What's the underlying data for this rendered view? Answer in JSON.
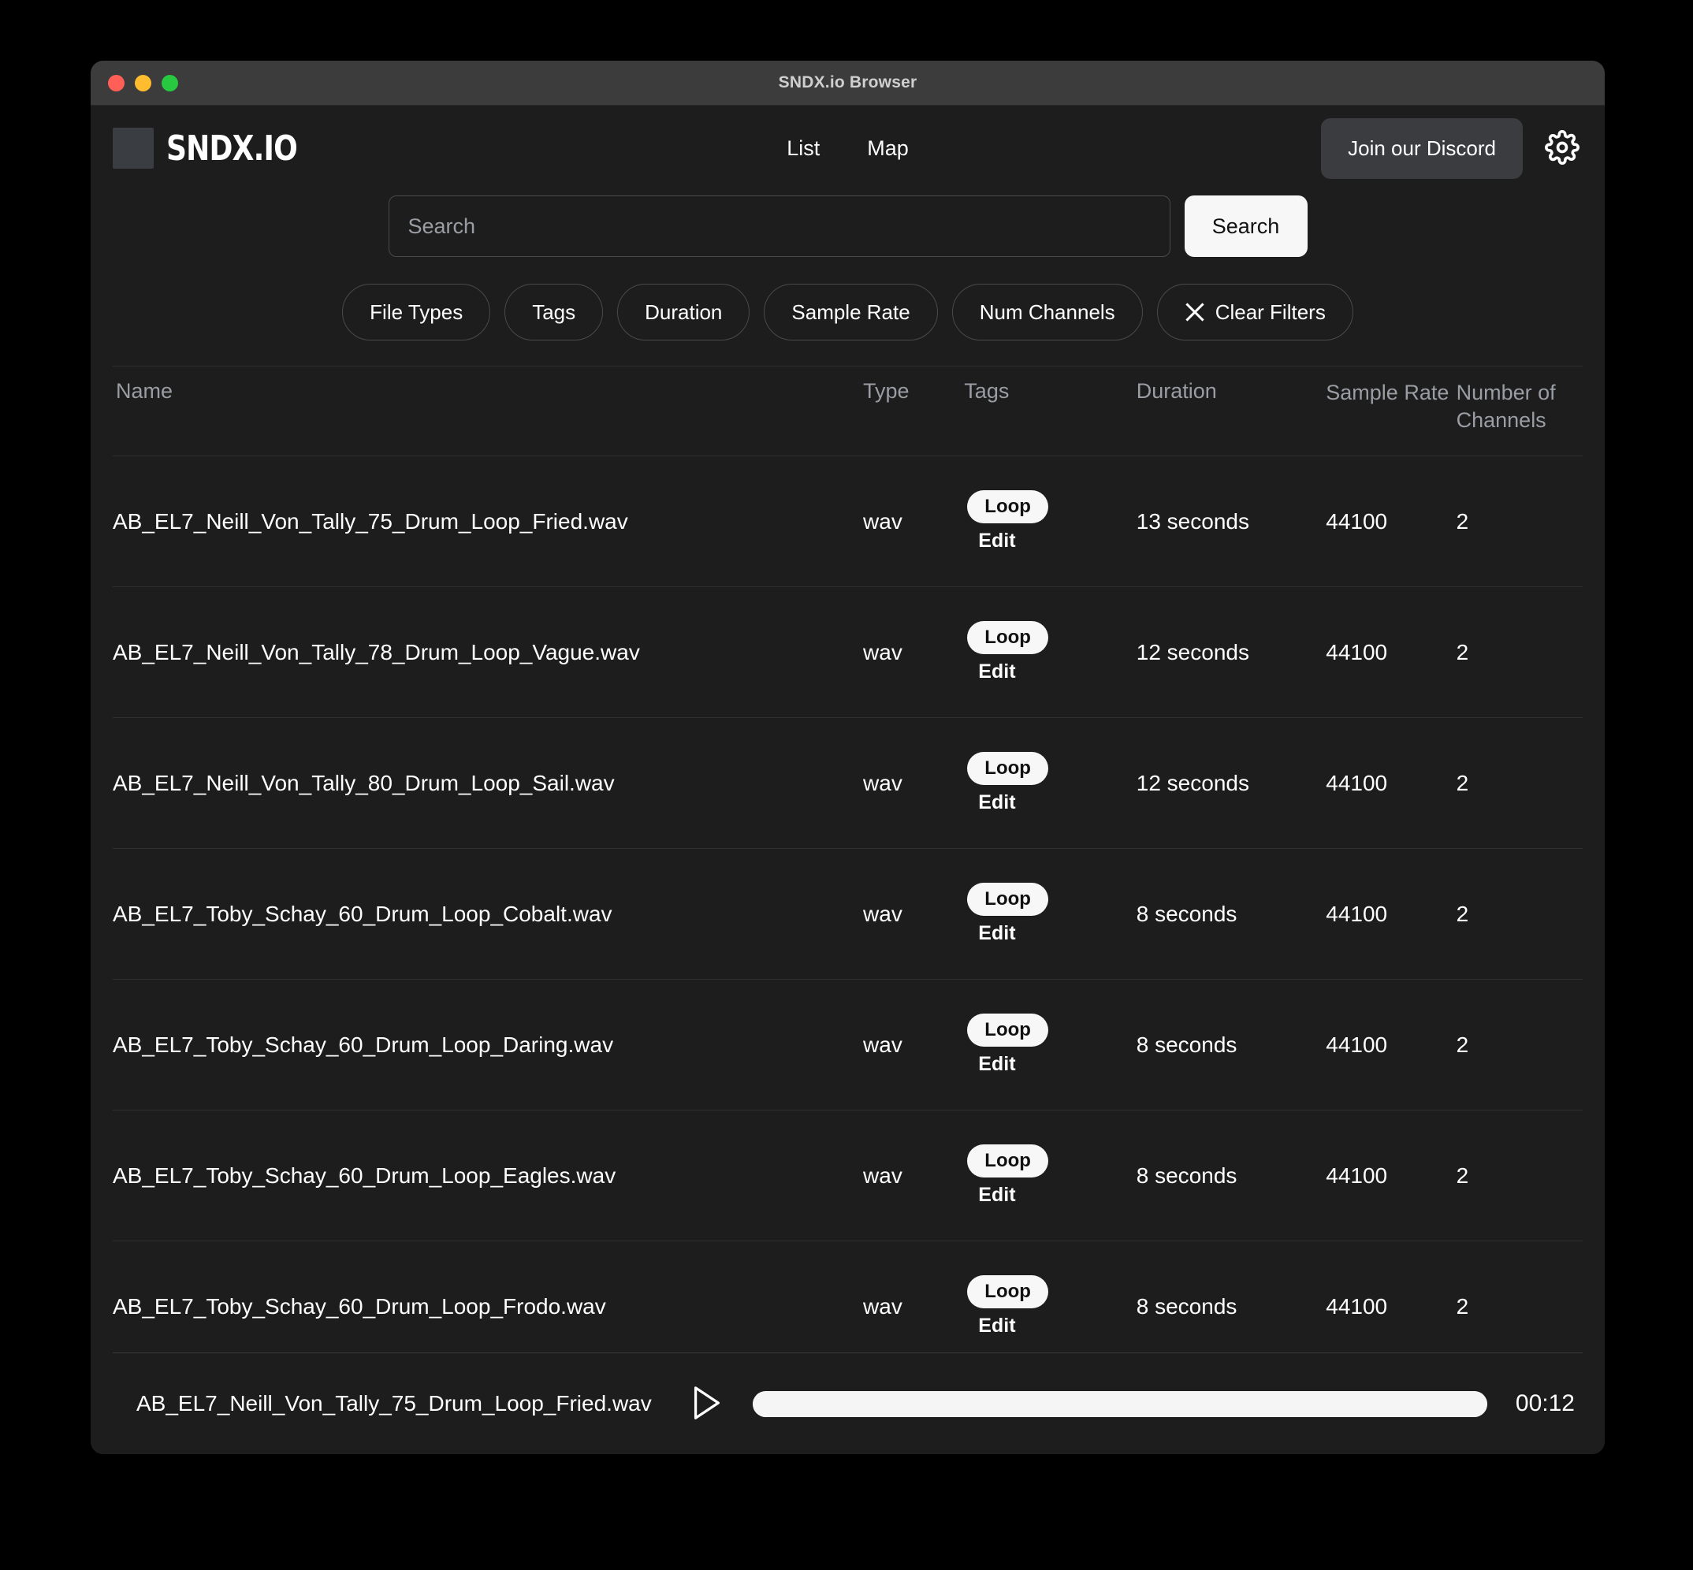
{
  "window": {
    "title": "SNDX.io Browser",
    "controls": [
      "close",
      "minimize",
      "maximize"
    ]
  },
  "header": {
    "brand_name": "SNDX.IO",
    "nav": [
      {
        "label": "List"
      },
      {
        "label": "Map"
      }
    ],
    "discord_label": "Join our Discord",
    "settings_icon": "gear-icon"
  },
  "search": {
    "value": "",
    "placeholder": "Search",
    "button_label": "Search"
  },
  "filters": [
    {
      "label": "File Types",
      "icon": null
    },
    {
      "label": "Tags",
      "icon": null
    },
    {
      "label": "Duration",
      "icon": null
    },
    {
      "label": "Sample Rate",
      "icon": null
    },
    {
      "label": "Num Channels",
      "icon": null
    },
    {
      "label": "Clear Filters",
      "icon": "x-icon"
    }
  ],
  "table": {
    "columns": [
      {
        "key": "name",
        "label": "Name"
      },
      {
        "key": "type",
        "label": "Type"
      },
      {
        "key": "tags",
        "label": "Tags"
      },
      {
        "key": "duration",
        "label": "Duration"
      },
      {
        "key": "sample_rate",
        "label": "Sample Rate"
      },
      {
        "key": "channels",
        "label": "Number of Channels"
      }
    ],
    "edit_label": "Edit",
    "rows": [
      {
        "name": "AB_EL7_Neill_Von_Tally_75_Drum_Loop_Fried.wav",
        "type": "wav",
        "tag": "Loop",
        "duration": "13 seconds",
        "sample_rate": "44100",
        "channels": "2"
      },
      {
        "name": "AB_EL7_Neill_Von_Tally_78_Drum_Loop_Vague.wav",
        "type": "wav",
        "tag": "Loop",
        "duration": "12 seconds",
        "sample_rate": "44100",
        "channels": "2"
      },
      {
        "name": "AB_EL7_Neill_Von_Tally_80_Drum_Loop_Sail.wav",
        "type": "wav",
        "tag": "Loop",
        "duration": "12 seconds",
        "sample_rate": "44100",
        "channels": "2"
      },
      {
        "name": "AB_EL7_Toby_Schay_60_Drum_Loop_Cobalt.wav",
        "type": "wav",
        "tag": "Loop",
        "duration": "8 seconds",
        "sample_rate": "44100",
        "channels": "2"
      },
      {
        "name": "AB_EL7_Toby_Schay_60_Drum_Loop_Daring.wav",
        "type": "wav",
        "tag": "Loop",
        "duration": "8 seconds",
        "sample_rate": "44100",
        "channels": "2"
      },
      {
        "name": "AB_EL7_Toby_Schay_60_Drum_Loop_Eagles.wav",
        "type": "wav",
        "tag": "Loop",
        "duration": "8 seconds",
        "sample_rate": "44100",
        "channels": "2"
      },
      {
        "name": "AB_EL7_Toby_Schay_60_Drum_Loop_Frodo.wav",
        "type": "wav",
        "tag": "Loop",
        "duration": "8 seconds",
        "sample_rate": "44100",
        "channels": "2"
      }
    ]
  },
  "player": {
    "filename": "AB_EL7_Neill_Von_Tally_75_Drum_Loop_Fried.wav",
    "play_icon": "play-icon",
    "progress_percent": 100,
    "time": "00:12"
  },
  "colors": {
    "window_bg": "#1d1d1d",
    "titlebar_bg": "#3c3c3c",
    "accent_light": "#f7f7f7",
    "muted_text": "#9a9da3",
    "divider": "#2f2f2f",
    "traffic_red": "#ff5f57",
    "traffic_yellow": "#febc2e",
    "traffic_green": "#28c840"
  }
}
